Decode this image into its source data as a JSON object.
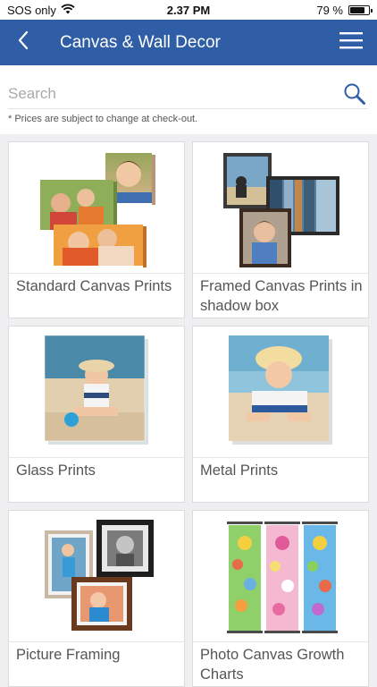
{
  "status_bar": {
    "carrier": "SOS only",
    "time": "2.37 PM",
    "battery": "79 %",
    "battery_level": 0.79
  },
  "header": {
    "title": "Canvas & Wall Decor"
  },
  "search": {
    "placeholder": "Search"
  },
  "disclaimer": "* Prices are subject to change at check-out.",
  "products": [
    {
      "label": "Standard Canvas Prints"
    },
    {
      "label": "Framed Canvas Prints in shadow box"
    },
    {
      "label": "Glass Prints"
    },
    {
      "label": "Metal Prints"
    },
    {
      "label": "Picture Framing"
    },
    {
      "label": "Photo Canvas Growth Charts"
    }
  ],
  "colors": {
    "nav_bar": "#2f5ea6",
    "background": "#efeff1",
    "card_border": "#dcdcdc",
    "text": "#555555"
  }
}
